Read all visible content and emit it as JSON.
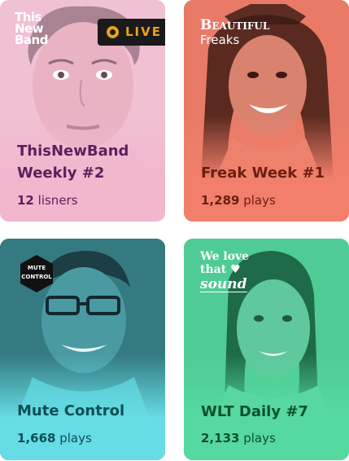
{
  "cards": [
    {
      "brand": [
        "This",
        "New",
        "Band"
      ],
      "live_label": "LIVE",
      "title": "ThisNewBand\nWeekly #2",
      "stat_value": "12",
      "stat_unit": "lisners",
      "color": "#f2b6cd",
      "text_color": "#5c1f5f"
    },
    {
      "brand": [
        "Beautiful",
        "Freaks"
      ],
      "title": "Freak Week #1",
      "stat_value": "1,289",
      "stat_unit": "plays",
      "color": "#f27f6b",
      "text_color": "#6a1e12"
    },
    {
      "brand": [
        "MUTE",
        "CONTROL"
      ],
      "title": "Mute Control",
      "stat_value": "1,668",
      "stat_unit": "plays",
      "color": "#66dce5",
      "text_color": "#0f4e57"
    },
    {
      "brand": [
        "We love",
        "that",
        "sound"
      ],
      "title": "WLT Daily #7",
      "stat_value": "2,133",
      "stat_unit": "plays",
      "color": "#55d99e",
      "text_color": "#0d5033"
    }
  ]
}
